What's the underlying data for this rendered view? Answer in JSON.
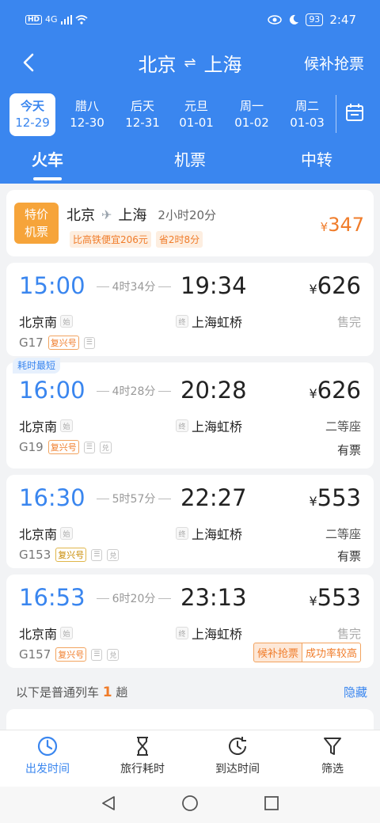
{
  "status": {
    "hd": "HD",
    "signal": "4G",
    "battery": "93",
    "time": "2:47"
  },
  "topbar": {
    "from": "北京",
    "swap": "⇌",
    "to": "上海",
    "action": "候补抢票"
  },
  "dates": [
    {
      "d1": "今天",
      "d2": "12-29"
    },
    {
      "d1": "腊八",
      "d2": "12-30"
    },
    {
      "d1": "后天",
      "d2": "12-31"
    },
    {
      "d1": "元旦",
      "d2": "01-01"
    },
    {
      "d1": "周一",
      "d2": "01-02"
    },
    {
      "d1": "周二",
      "d2": "01-03"
    }
  ],
  "tabs": [
    "火车",
    "机票",
    "中转"
  ],
  "promo": {
    "badge_line1": "特价",
    "badge_line2": "机票",
    "from": "北京",
    "to": "上海",
    "duration": "2小时20分",
    "tag1": "比高铁便宜206元",
    "tag2": "省2时8分",
    "price_symbol": "¥",
    "price": "347"
  },
  "trains": [
    {
      "dep": "15:00",
      "dur": "4时34分",
      "arr": "19:34",
      "price": "626",
      "from": "北京南",
      "from_mark": "始",
      "to": "上海虹桥",
      "to_mark": "终",
      "no": "G17",
      "type": "复兴号",
      "seat": "售完",
      "avail": "",
      "fastest": "",
      "icon_a": "☰",
      "icon_b": ""
    },
    {
      "dep": "16:00",
      "dur": "4时28分",
      "arr": "20:28",
      "price": "626",
      "from": "北京南",
      "from_mark": "始",
      "to": "上海虹桥",
      "to_mark": "终",
      "no": "G19",
      "type": "复兴号",
      "seat": "二等座",
      "avail": "有票",
      "fastest": "耗时最短",
      "icon_a": "☰",
      "icon_b": "兑"
    },
    {
      "dep": "16:30",
      "dur": "5时57分",
      "arr": "22:27",
      "price": "553",
      "from": "北京南",
      "from_mark": "始",
      "to": "上海虹桥",
      "to_mark": "终",
      "no": "G153",
      "type": "复兴号",
      "seat": "二等座",
      "avail": "有票",
      "fastest": "",
      "icon_a": "☰",
      "icon_b": "兑"
    },
    {
      "dep": "16:53",
      "dur": "6时20分",
      "arr": "23:13",
      "price": "553",
      "from": "北京南",
      "from_mark": "始",
      "to": "上海虹桥",
      "to_mark": "终",
      "no": "G157",
      "type": "复兴号",
      "seat": "售完",
      "avail": "",
      "fastest": "",
      "icon_a": "☰",
      "icon_b": "兑",
      "wait1": "候补抢票",
      "wait2": "成功率较高"
    }
  ],
  "yen": "¥",
  "section": {
    "prefix": "以下是普通列车",
    "count": "1",
    "suffix": "趟",
    "hide": "隐藏"
  },
  "nav": [
    "出发时间",
    "旅行耗时",
    "到达时间",
    "筛选"
  ]
}
